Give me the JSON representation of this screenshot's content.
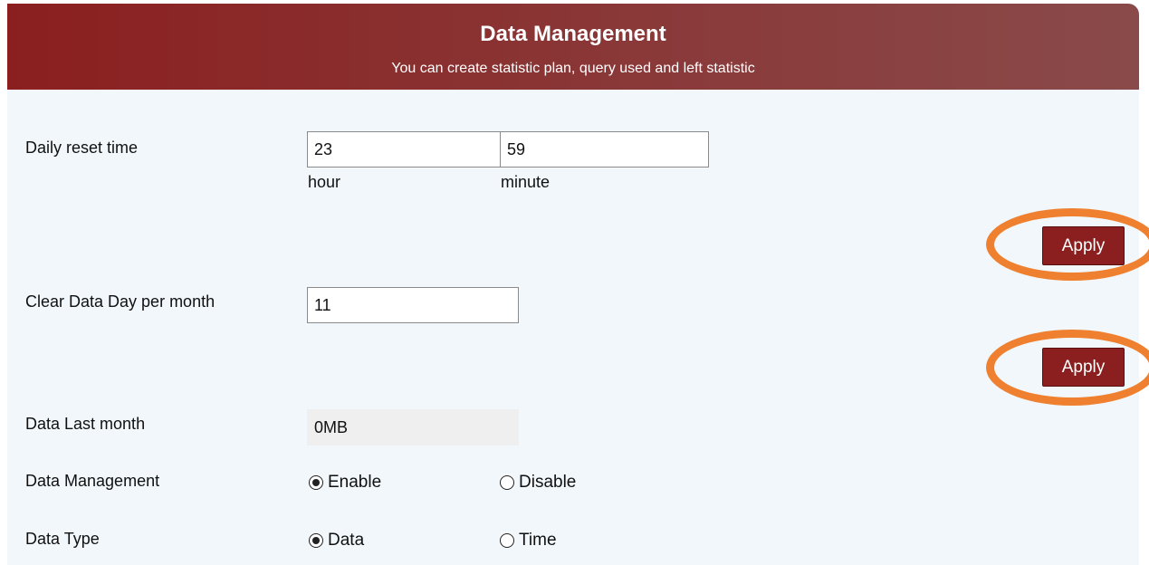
{
  "header": {
    "title": "Data Management",
    "subtitle": "You can create statistic plan, query used and left statistic"
  },
  "daily_reset": {
    "label": "Daily reset time",
    "hour_value": "23",
    "minute_value": "59",
    "hour_caption": "hour",
    "minute_caption": "minute",
    "apply_label": "Apply"
  },
  "clear_day": {
    "label": "Clear Data Day per month",
    "value": "11",
    "apply_label": "Apply"
  },
  "last_month": {
    "label": "Data Last month",
    "value": "0MB"
  },
  "data_management": {
    "label": "Data Management",
    "options": [
      {
        "label": "Enable",
        "checked": true
      },
      {
        "label": "Disable",
        "checked": false
      }
    ]
  },
  "data_type": {
    "label": "Data Type",
    "options": [
      {
        "label": "Data",
        "checked": true
      },
      {
        "label": "Time",
        "checked": false
      }
    ]
  },
  "colors": {
    "header_bg": "#8b1f1f",
    "content_bg": "#f1f7fa",
    "button_bg": "#8b1f1f",
    "highlight_ring": "#ef8030"
  }
}
